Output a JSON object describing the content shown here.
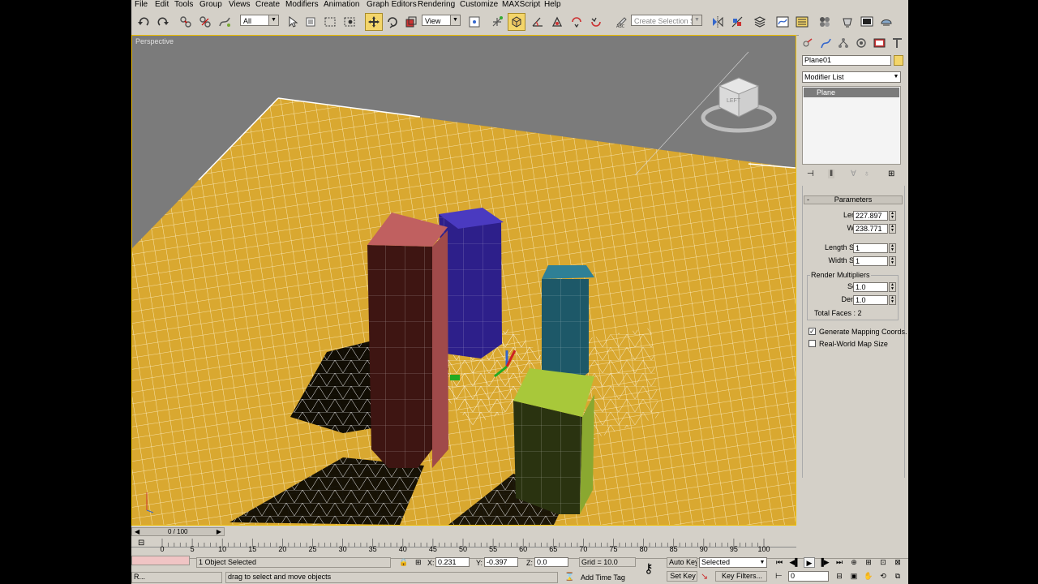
{
  "menu": [
    "File",
    "Edit",
    "Tools",
    "Group",
    "Views",
    "Create",
    "Modifiers",
    "Animation",
    "Graph Editors",
    "Rendering",
    "Customize",
    "MAXScript",
    "Help"
  ],
  "toolbar": {
    "selection_filter": "All",
    "ref_coord": "View",
    "named_selection_placeholder": "Create Selection Set"
  },
  "viewport": {
    "label": "Perspective",
    "viewcube_label": "LEFT"
  },
  "command_panel": {
    "object_name": "Plane01",
    "modifier_list": "Modifier List",
    "stack_item": "Plane",
    "rollout_title": "Parameters",
    "length_label": "Length:",
    "length_value": "227.897",
    "width_label": "Width:",
    "width_value": "238.771",
    "length_segs_label": "Length Segs:",
    "length_segs_value": "1",
    "width_segs_label": "Width Segs:",
    "width_segs_value": "1",
    "render_multipliers_label": "Render Multipliers",
    "scale_label": "Scale:",
    "scale_value": "1.0",
    "density_label": "Density:",
    "density_value": "1.0",
    "total_faces": "Total Faces : 2",
    "gen_mapping_label": "Generate Mapping Coords.",
    "gen_mapping_checked": true,
    "real_world_label": "Real-World Map Size",
    "real_world_checked": false
  },
  "timeline": {
    "slider_label": "0 / 100",
    "ticks": [
      "0",
      "5",
      "10",
      "15",
      "20",
      "25",
      "30",
      "35",
      "40",
      "45",
      "50",
      "55",
      "60",
      "65",
      "70",
      "75",
      "80",
      "85",
      "90",
      "95",
      "100"
    ]
  },
  "status": {
    "selection_text": "1 Object Selected",
    "prompt_text": "drag to select and move objects",
    "x_label": "X:",
    "x_value": "0.231",
    "y_label": "Y:",
    "y_value": "-0.397",
    "z_label": "Z:",
    "z_value": "0.0",
    "grid": "Grid = 10.0",
    "add_time_tag": "Add Time Tag",
    "auto_key": "Auto Key",
    "set_key": "Set Key",
    "key_mode": "Selected",
    "key_filters": "Key Filters...",
    "frame_value": "0",
    "taskbar_label": "R..."
  },
  "colors": {
    "ground": "#d9a830",
    "red_box": "#8a3a3a",
    "blue_box": "#3a2a9a",
    "cyan_box": "#2a6a7a",
    "green_box": "#7a9a2a",
    "highlight": "#f3d56a"
  }
}
